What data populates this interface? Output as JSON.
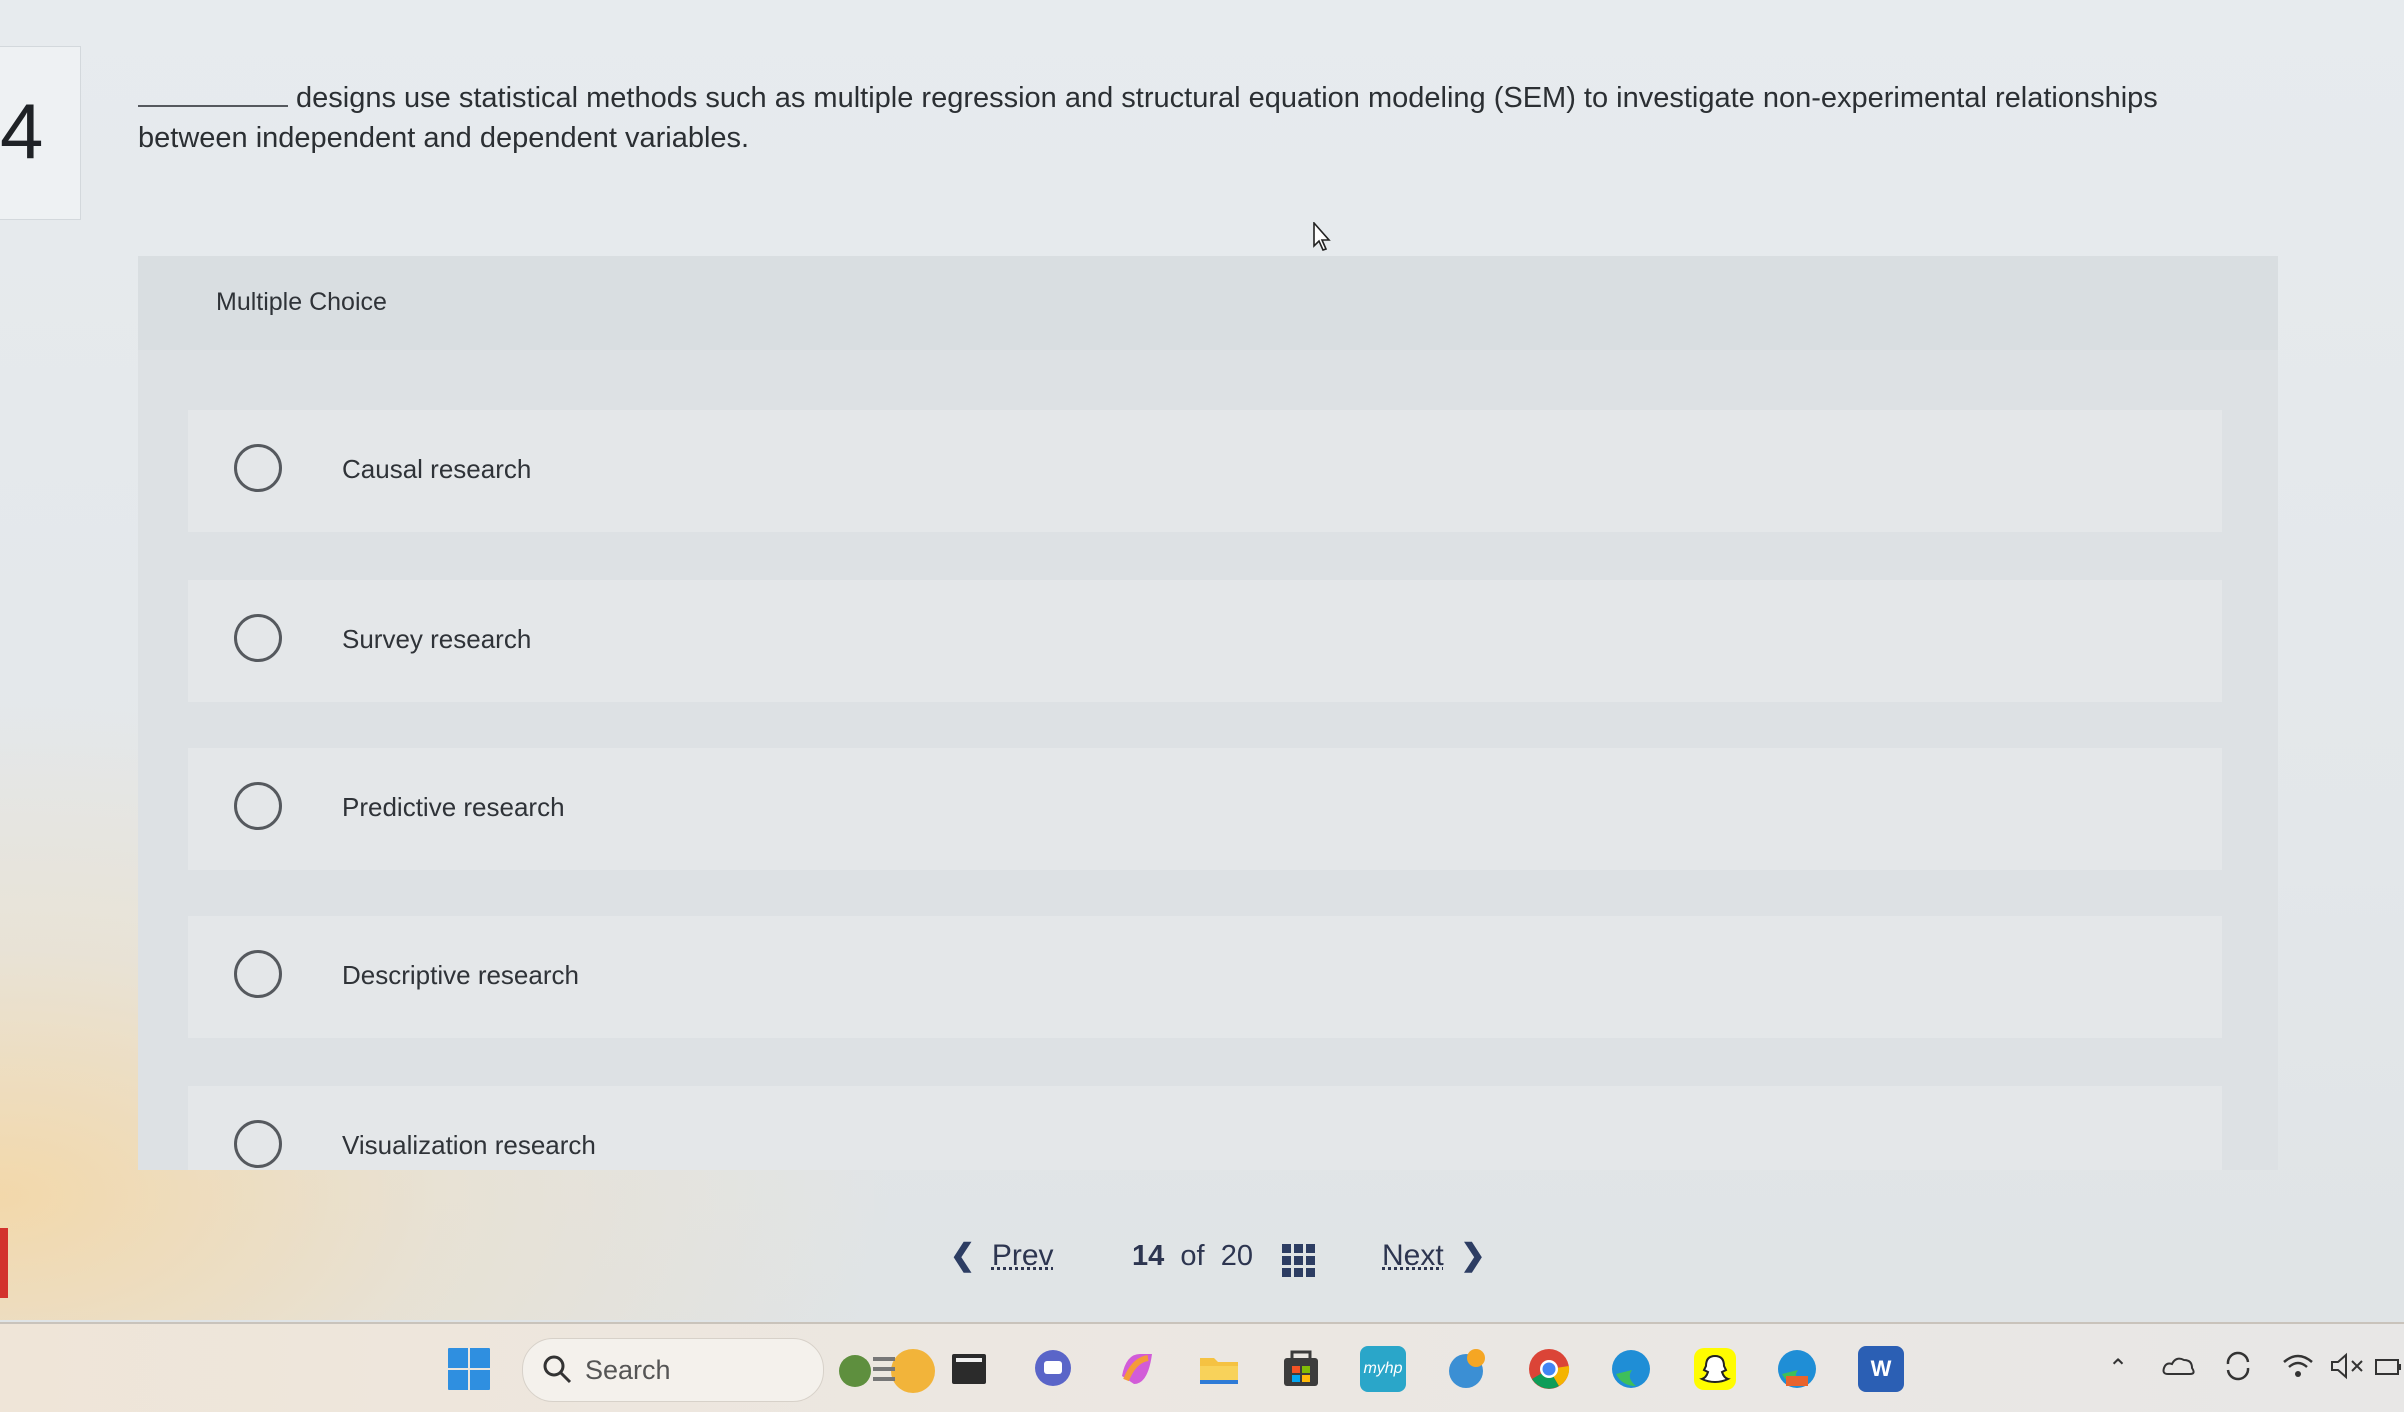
{
  "question": {
    "number": "4",
    "text": "designs use statistical methods such as multiple regression and structural equation modeling (SEM) to investigate non-experimental relationships between independent and dependent variables."
  },
  "multiple_choice": {
    "header": "Multiple Choice",
    "options": [
      {
        "label": "Causal research"
      },
      {
        "label": "Survey research"
      },
      {
        "label": "Predictive research"
      },
      {
        "label": "Descriptive research"
      },
      {
        "label": "Visualization research"
      }
    ]
  },
  "navigation": {
    "prev_label": "Prev",
    "next_label": "Next",
    "current": "14",
    "of_label": "of",
    "total": "20"
  },
  "taskbar": {
    "search_placeholder": "Search",
    "apps": [
      "windows-start-icon",
      "search-icon",
      "widgets-icon",
      "file-explorer-dark-icon",
      "teams-chat-icon",
      "copilot-icon",
      "folder-icon",
      "store-icon",
      "myhp-icon",
      "app-icon",
      "chrome-icon",
      "edge-icon",
      "snapchat-icon",
      "edge-active-icon",
      "word-icon"
    ],
    "myhp_label": "myhp",
    "word_letter": "W"
  },
  "colors": {
    "panel_bg": "#dde1e4",
    "choice_bg": "#e4e7e9",
    "nav_text": "#2d3550"
  }
}
